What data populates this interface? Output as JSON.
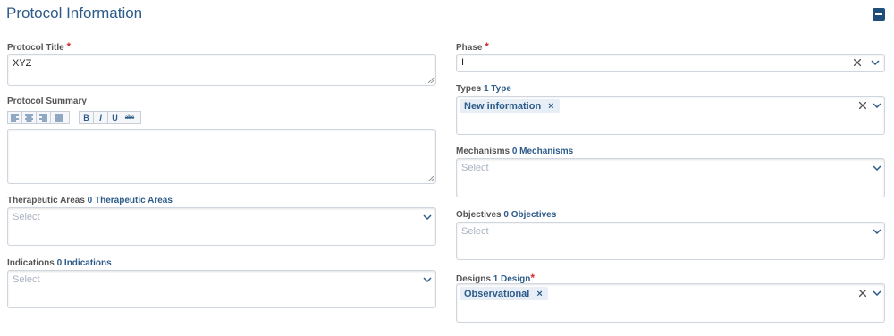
{
  "header": {
    "title": "Protocol Information"
  },
  "left": {
    "protocol_title": {
      "label": "Protocol Title",
      "required": "*",
      "value": "XYZ"
    },
    "protocol_summary": {
      "label": "Protocol Summary"
    },
    "toolbar": {
      "align": [
        "align-left-icon",
        "align-center-icon",
        "align-right-icon",
        "align-justify-icon"
      ],
      "format": {
        "bold": "B",
        "italic": "I",
        "underline": "U",
        "strike": "abc"
      }
    },
    "therapeutic_areas": {
      "label": "Therapeutic Areas",
      "count": "0 Therapeutic Areas",
      "placeholder": "Select"
    },
    "indications": {
      "label": "Indications",
      "count": "0 Indications",
      "placeholder": "Select"
    }
  },
  "right": {
    "phase": {
      "label": "Phase",
      "required": "*",
      "value": "I"
    },
    "types": {
      "label": "Types",
      "count": "1 Type",
      "chip": "New information",
      "chip_remove": "×"
    },
    "mechanisms": {
      "label": "Mechanisms",
      "count": "0 Mechanisms",
      "placeholder": "Select"
    },
    "objectives": {
      "label": "Objectives",
      "count": "0 Objectives",
      "placeholder": "Select"
    },
    "designs": {
      "label": "Designs",
      "count": "1 Design",
      "required": "*",
      "chip": "Observational",
      "chip_remove": "×"
    }
  },
  "colors": {
    "accent": "#2d5b8a",
    "required": "#d32f2f",
    "placeholder": "#a7b2c1",
    "chip_bg": "#e7eef6"
  }
}
